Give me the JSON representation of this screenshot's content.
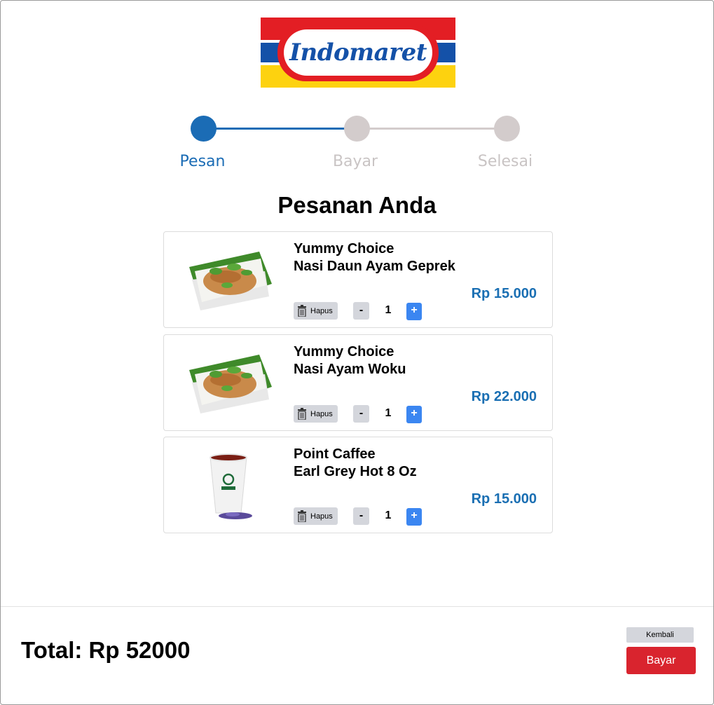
{
  "brand": {
    "logo_text": "Indomaret"
  },
  "stepper": {
    "steps": [
      "Pesan",
      "Bayar",
      "Selesai"
    ],
    "active_color": "#1b6cb5",
    "inactive_color": "#d3cccc"
  },
  "page_title": "Pesanan Anda",
  "cart": {
    "delete_label": "Hapus",
    "minus_label": "-",
    "plus_label": "+",
    "items": [
      {
        "name_line1": "Yummy Choice",
        "name_line2": "Nasi Daun Ayam Geprek",
        "price": "Rp 15.000",
        "qty": "1",
        "image": "rice-box-image"
      },
      {
        "name_line1": "Yummy Choice",
        "name_line2": "Nasi Ayam Woku",
        "price": "Rp 22.000",
        "qty": "1",
        "image": "rice-box-image"
      },
      {
        "name_line1": "Point Caffee",
        "name_line2": "Earl Grey Hot 8 Oz",
        "price": "Rp 15.000",
        "qty": "1",
        "image": "tea-cup-image"
      }
    ]
  },
  "footer": {
    "total": "Total: Rp 52000",
    "back_label": "Kembali",
    "pay_label": "Bayar"
  },
  "colors": {
    "price": "#1a6fb3",
    "pay_button": "#d9242e",
    "plus_button": "#3b86f1"
  }
}
